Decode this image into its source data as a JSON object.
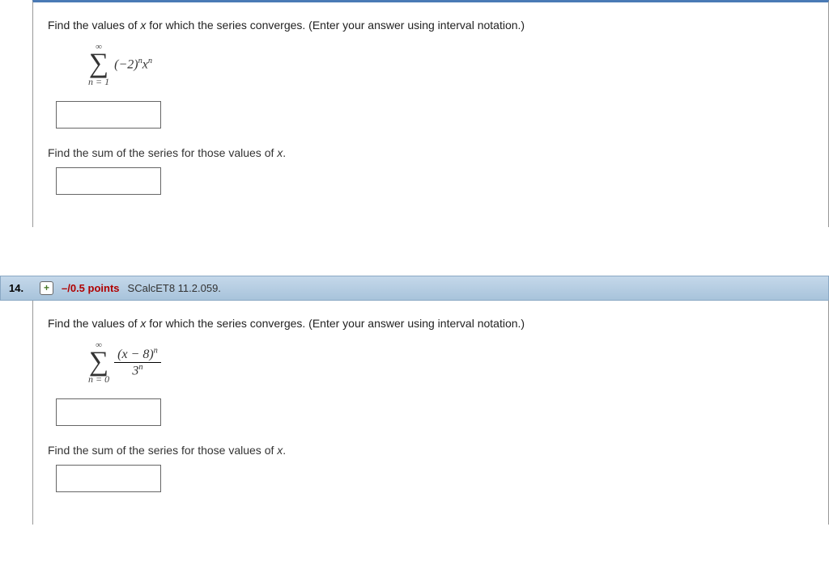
{
  "q13": {
    "prompt_prefix": "Find the values of ",
    "prompt_var": "x",
    "prompt_suffix": " for which the series converges. (Enter your answer using interval notation.)",
    "sigma_top": "∞",
    "sigma_bot": "n = 1",
    "term_a": "(−2)",
    "term_a_sup": "n",
    "term_b": "x",
    "term_b_sup": "n",
    "sub_prefix": "Find the sum of the series for those values of ",
    "sub_var": "x",
    "sub_suffix": "."
  },
  "q14": {
    "number": "14.",
    "expand": "+",
    "points": "–/0.5 points",
    "source": "SCalcET8 11.2.059.",
    "prompt_prefix": "Find the values of ",
    "prompt_var": "x",
    "prompt_suffix": " for which the series converges. (Enter your answer using interval notation.)",
    "sigma_top": "∞",
    "sigma_bot": "n = 0",
    "num_a": "(",
    "num_var": "x",
    "num_b": " − 8)",
    "num_sup": "n",
    "den_base": "3",
    "den_sup": "n",
    "sub_prefix": "Find the sum of the series for those values of ",
    "sub_var": "x",
    "sub_suffix": "."
  }
}
